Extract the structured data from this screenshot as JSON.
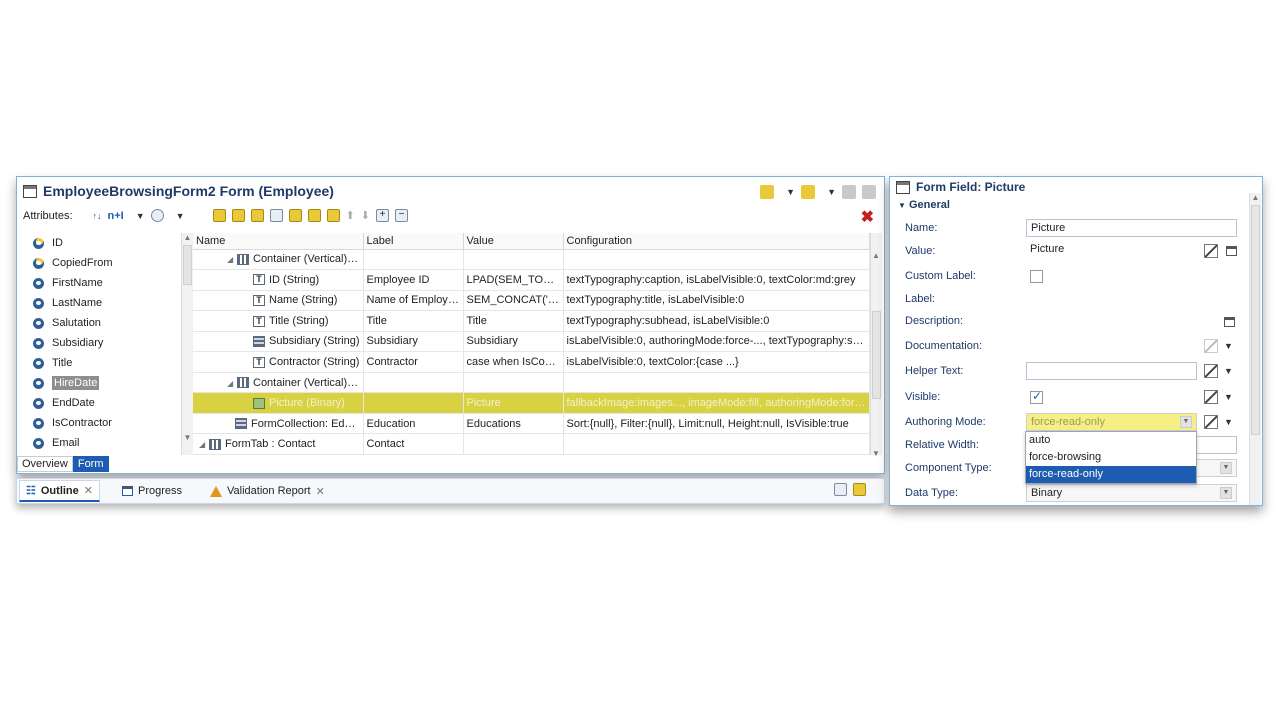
{
  "editor": {
    "title": "EmployeeBrowsingForm2 Form (Employee)",
    "attributes_label": "Attributes:",
    "sort_label": "n+I"
  },
  "attributes": [
    {
      "label": "ID",
      "icon": "attribute-key-icon"
    },
    {
      "label": "CopiedFrom",
      "icon": "attribute-key-icon"
    },
    {
      "label": "FirstName",
      "icon": "attribute-icon"
    },
    {
      "label": "LastName",
      "icon": "attribute-icon"
    },
    {
      "label": "Salutation",
      "icon": "attribute-icon"
    },
    {
      "label": "Subsidiary",
      "icon": "attribute-icon"
    },
    {
      "label": "Title",
      "icon": "attribute-icon"
    },
    {
      "label": "HireDate",
      "icon": "attribute-icon",
      "selected": true
    },
    {
      "label": "EndDate",
      "icon": "attribute-icon"
    },
    {
      "label": "IsContractor",
      "icon": "attribute-icon"
    },
    {
      "label": "Email",
      "icon": "attribute-icon"
    }
  ],
  "editor_tabs": [
    "Overview",
    "Form"
  ],
  "table": {
    "headers": [
      "Name",
      "Label",
      "Value",
      "Configuration"
    ],
    "rows": [
      {
        "name": "Container (Vertical): ...",
        "label": "",
        "value": "",
        "config": "",
        "icon": "container-icon",
        "indent": 1,
        "twisty": true
      },
      {
        "name": "ID (String)",
        "label": "Employee ID",
        "value": "LPAD(SEM_TO_CH...",
        "config": "textTypography:caption, isLabelVisible:0, textColor:md:grey",
        "icon": "text-field-icon",
        "indent": 2
      },
      {
        "name": "Name (String)",
        "label": "Name of Employee",
        "value": "SEM_CONCAT(' ', '...",
        "config": "textTypography:title, isLabelVisible:0",
        "icon": "text-field-icon",
        "indent": 2
      },
      {
        "name": "Title (String)",
        "label": "Title",
        "value": "Title",
        "config": "textTypography:subhead, isLabelVisible:0",
        "icon": "text-field-icon",
        "indent": 2
      },
      {
        "name": "Subsidiary (String)",
        "label": "Subsidiary",
        "value": "Subsidiary",
        "config": "isLabelVisible:0, authoringMode:force-..., textTypography:subhead",
        "icon": "list-field-icon",
        "indent": 2
      },
      {
        "name": "Contractor (String)",
        "label": "Contractor",
        "value": "case when IsContr...",
        "config": "isLabelVisible:0, textColor:{case ...}",
        "icon": "text-field-icon",
        "indent": 2
      },
      {
        "name": "Container (Vertical): ...",
        "label": "",
        "value": "",
        "config": "",
        "icon": "container-icon",
        "indent": 1,
        "twisty": true
      },
      {
        "name": "Picture (Binary)",
        "label": "",
        "value": "Picture",
        "config": "fallbackImage:images..., imageMode:fill, authoringMode:force-...",
        "icon": "picture-icon",
        "indent": 2,
        "highlight": true
      },
      {
        "name": "FormCollection: Educ...",
        "label": "Education",
        "value": "Educations",
        "config": "Sort:{null}, Filter:{null}, Limit:null, Height:null, IsVisible:true",
        "icon": "collection-icon",
        "indent": 1
      },
      {
        "name": "FormTab : Contact",
        "label": "Contact",
        "value": "",
        "config": "",
        "icon": "tab-icon",
        "indent": 0,
        "twisty": true
      }
    ]
  },
  "lower_tabs": [
    {
      "label": "Outline",
      "icon": "outline-icon",
      "active": true
    },
    {
      "label": "Progress",
      "icon": "progress-icon"
    },
    {
      "label": "Validation Report",
      "icon": "warning-icon"
    }
  ],
  "props": {
    "title": "Form Field: Picture",
    "section": "General",
    "fields": {
      "name_label": "Name:",
      "name_value": "Picture",
      "value_label": "Value:",
      "value_value": "Picture",
      "custom_label": "Custom Label:",
      "label_label": "Label:",
      "description_label": "Description:",
      "documentation_label": "Documentation:",
      "helper_label": "Helper Text:",
      "visible_label": "Visible:",
      "authoring_label": "Authoring Mode:",
      "authoring_value": "force-read-only",
      "relwidth_label": "Relative Width:",
      "component_label": "Component Type:",
      "datatype_label": "Data Type:",
      "datatype_value": "Binary"
    },
    "authoring_options": [
      "auto",
      "force-browsing",
      "force-read-only"
    ],
    "authoring_selected": "force-read-only",
    "visible_checked": true,
    "custom_label_checked": false
  },
  "colors": {
    "accent": "#1d5cb0",
    "highlight_row": "#d8d142",
    "highlight_field": "#f5ef86",
    "close": "#c51f1f"
  }
}
